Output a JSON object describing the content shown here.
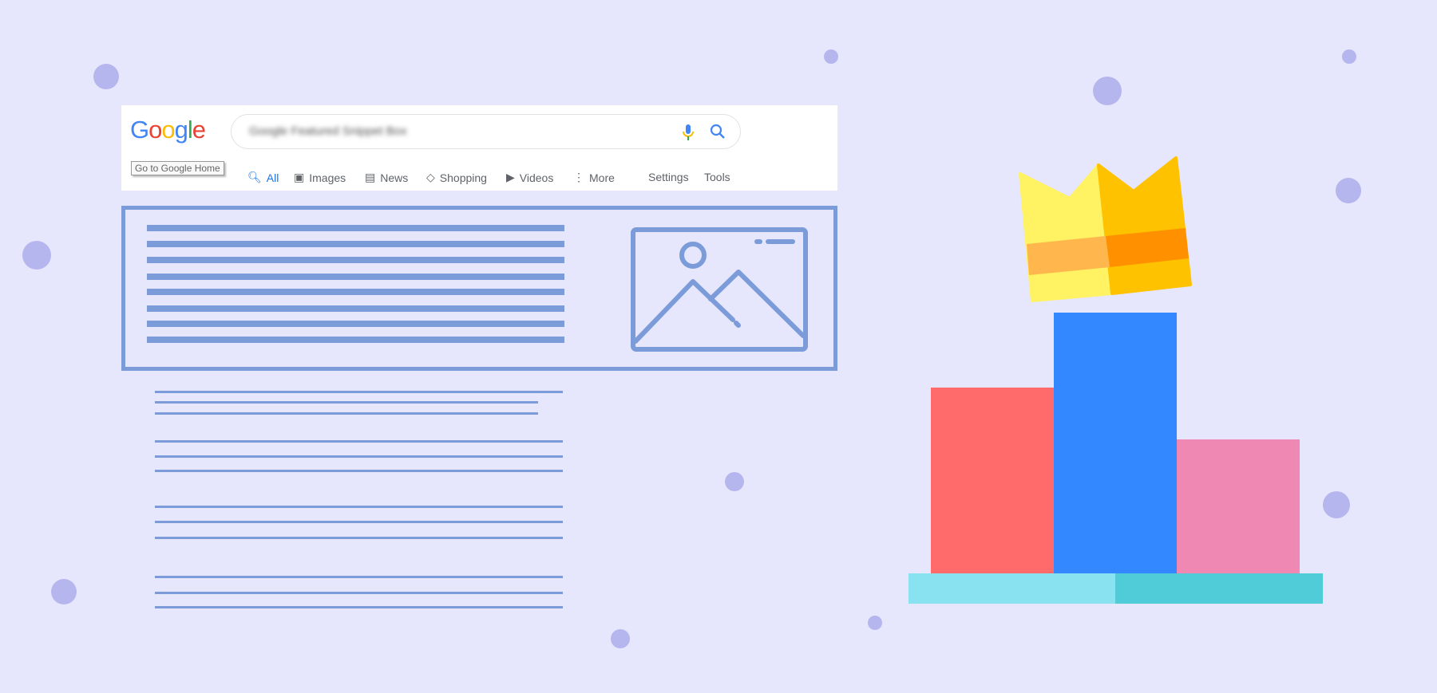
{
  "header": {
    "logo": "Google",
    "search_query": "Google Featured Snippet Box",
    "tooltip": "Go to Google Home",
    "tabs": [
      {
        "label": "All",
        "icon": "search-icon",
        "active": true
      },
      {
        "label": "Images",
        "icon": "image-icon"
      },
      {
        "label": "News",
        "icon": "news-icon"
      },
      {
        "label": "Shopping",
        "icon": "tag-icon"
      },
      {
        "label": "Videos",
        "icon": "play-icon"
      },
      {
        "label": "More",
        "icon": "more-vertical-icon"
      }
    ],
    "settings": "Settings",
    "tools": "Tools"
  },
  "colors": {
    "background": "#e6e6fc",
    "dots": "#b6b6ee",
    "lines": "#7b9bd9",
    "bar_left": "#ff6b6b",
    "bar_center": "#3388ff",
    "bar_right": "#ef89b4",
    "base_left": "#88e2f0",
    "base_right": "#50ccd9",
    "crown_light": "#fff263",
    "crown_dark": "#ffc200",
    "band_light": "#ffb64c",
    "band_dark": "#ff9100"
  }
}
